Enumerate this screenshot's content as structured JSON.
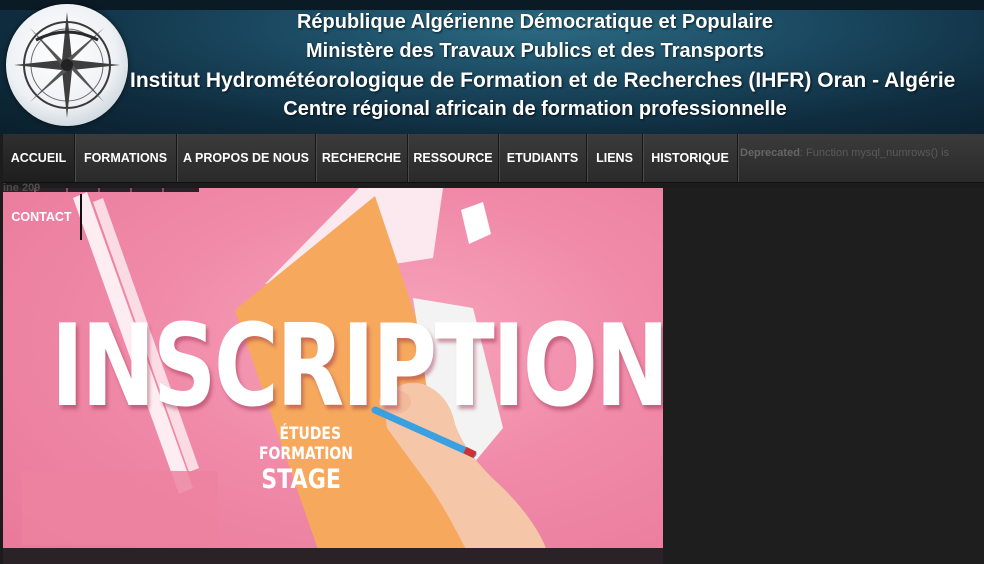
{
  "header": {
    "line1": "République Algérienne Démocratique et Populaire",
    "line2": "Ministère des Travaux Publics et des Transports",
    "line3": "Institut Hydrométéorologique de Formation et de Recherches (IHFR)  Oran - Algérie",
    "line4": "Centre régional africain de formation professionnelle"
  },
  "nav": {
    "items": [
      {
        "label": "ACCUEIL"
      },
      {
        "label": "FORMATIONS"
      },
      {
        "label": "A PROPOS DE NOUS"
      },
      {
        "label": "RECHERCHE"
      },
      {
        "label": "RESSOURCE"
      },
      {
        "label": "ETUDIANTS"
      },
      {
        "label": "LIENS"
      },
      {
        "label": "HISTORIQUE"
      }
    ],
    "contact": "CONTACT"
  },
  "warning": {
    "title": "Deprecated",
    "text": ": Function mysql_numrows() is",
    "tail": "ine 209"
  },
  "banner": {
    "headline": "INSCRIPTION",
    "sub1": "ÉTUDES",
    "sub2": "FORMATION",
    "sub3": "STAGE"
  },
  "colors": {
    "nav_bg": "#2f2f2f",
    "banner_pink": "#f08aa8",
    "folder_orange": "#f6a85d"
  }
}
